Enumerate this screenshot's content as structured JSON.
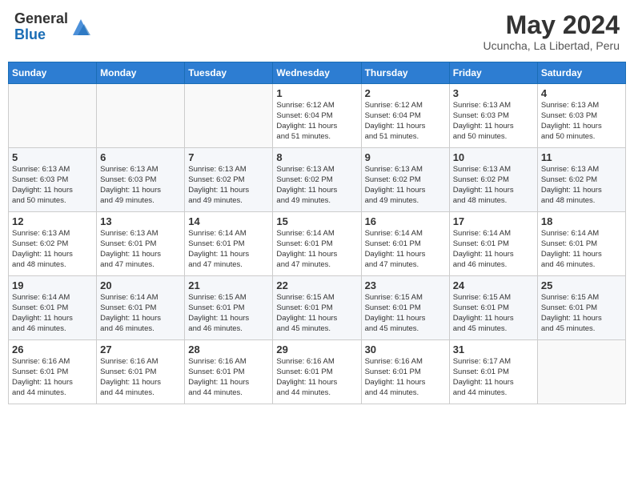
{
  "header": {
    "logo_general": "General",
    "logo_blue": "Blue",
    "month_year": "May 2024",
    "location": "Ucuncha, La Libertad, Peru"
  },
  "columns": [
    "Sunday",
    "Monday",
    "Tuesday",
    "Wednesday",
    "Thursday",
    "Friday",
    "Saturday"
  ],
  "weeks": [
    [
      {
        "day": "",
        "info": ""
      },
      {
        "day": "",
        "info": ""
      },
      {
        "day": "",
        "info": ""
      },
      {
        "day": "1",
        "info": "Sunrise: 6:12 AM\nSunset: 6:04 PM\nDaylight: 11 hours\nand 51 minutes."
      },
      {
        "day": "2",
        "info": "Sunrise: 6:12 AM\nSunset: 6:04 PM\nDaylight: 11 hours\nand 51 minutes."
      },
      {
        "day": "3",
        "info": "Sunrise: 6:13 AM\nSunset: 6:03 PM\nDaylight: 11 hours\nand 50 minutes."
      },
      {
        "day": "4",
        "info": "Sunrise: 6:13 AM\nSunset: 6:03 PM\nDaylight: 11 hours\nand 50 minutes."
      }
    ],
    [
      {
        "day": "5",
        "info": "Sunrise: 6:13 AM\nSunset: 6:03 PM\nDaylight: 11 hours\nand 50 minutes."
      },
      {
        "day": "6",
        "info": "Sunrise: 6:13 AM\nSunset: 6:03 PM\nDaylight: 11 hours\nand 49 minutes."
      },
      {
        "day": "7",
        "info": "Sunrise: 6:13 AM\nSunset: 6:02 PM\nDaylight: 11 hours\nand 49 minutes."
      },
      {
        "day": "8",
        "info": "Sunrise: 6:13 AM\nSunset: 6:02 PM\nDaylight: 11 hours\nand 49 minutes."
      },
      {
        "day": "9",
        "info": "Sunrise: 6:13 AM\nSunset: 6:02 PM\nDaylight: 11 hours\nand 49 minutes."
      },
      {
        "day": "10",
        "info": "Sunrise: 6:13 AM\nSunset: 6:02 PM\nDaylight: 11 hours\nand 48 minutes."
      },
      {
        "day": "11",
        "info": "Sunrise: 6:13 AM\nSunset: 6:02 PM\nDaylight: 11 hours\nand 48 minutes."
      }
    ],
    [
      {
        "day": "12",
        "info": "Sunrise: 6:13 AM\nSunset: 6:02 PM\nDaylight: 11 hours\nand 48 minutes."
      },
      {
        "day": "13",
        "info": "Sunrise: 6:13 AM\nSunset: 6:01 PM\nDaylight: 11 hours\nand 47 minutes."
      },
      {
        "day": "14",
        "info": "Sunrise: 6:14 AM\nSunset: 6:01 PM\nDaylight: 11 hours\nand 47 minutes."
      },
      {
        "day": "15",
        "info": "Sunrise: 6:14 AM\nSunset: 6:01 PM\nDaylight: 11 hours\nand 47 minutes."
      },
      {
        "day": "16",
        "info": "Sunrise: 6:14 AM\nSunset: 6:01 PM\nDaylight: 11 hours\nand 47 minutes."
      },
      {
        "day": "17",
        "info": "Sunrise: 6:14 AM\nSunset: 6:01 PM\nDaylight: 11 hours\nand 46 minutes."
      },
      {
        "day": "18",
        "info": "Sunrise: 6:14 AM\nSunset: 6:01 PM\nDaylight: 11 hours\nand 46 minutes."
      }
    ],
    [
      {
        "day": "19",
        "info": "Sunrise: 6:14 AM\nSunset: 6:01 PM\nDaylight: 11 hours\nand 46 minutes."
      },
      {
        "day": "20",
        "info": "Sunrise: 6:14 AM\nSunset: 6:01 PM\nDaylight: 11 hours\nand 46 minutes."
      },
      {
        "day": "21",
        "info": "Sunrise: 6:15 AM\nSunset: 6:01 PM\nDaylight: 11 hours\nand 46 minutes."
      },
      {
        "day": "22",
        "info": "Sunrise: 6:15 AM\nSunset: 6:01 PM\nDaylight: 11 hours\nand 45 minutes."
      },
      {
        "day": "23",
        "info": "Sunrise: 6:15 AM\nSunset: 6:01 PM\nDaylight: 11 hours\nand 45 minutes."
      },
      {
        "day": "24",
        "info": "Sunrise: 6:15 AM\nSunset: 6:01 PM\nDaylight: 11 hours\nand 45 minutes."
      },
      {
        "day": "25",
        "info": "Sunrise: 6:15 AM\nSunset: 6:01 PM\nDaylight: 11 hours\nand 45 minutes."
      }
    ],
    [
      {
        "day": "26",
        "info": "Sunrise: 6:16 AM\nSunset: 6:01 PM\nDaylight: 11 hours\nand 44 minutes."
      },
      {
        "day": "27",
        "info": "Sunrise: 6:16 AM\nSunset: 6:01 PM\nDaylight: 11 hours\nand 44 minutes."
      },
      {
        "day": "28",
        "info": "Sunrise: 6:16 AM\nSunset: 6:01 PM\nDaylight: 11 hours\nand 44 minutes."
      },
      {
        "day": "29",
        "info": "Sunrise: 6:16 AM\nSunset: 6:01 PM\nDaylight: 11 hours\nand 44 minutes."
      },
      {
        "day": "30",
        "info": "Sunrise: 6:16 AM\nSunset: 6:01 PM\nDaylight: 11 hours\nand 44 minutes."
      },
      {
        "day": "31",
        "info": "Sunrise: 6:17 AM\nSunset: 6:01 PM\nDaylight: 11 hours\nand 44 minutes."
      },
      {
        "day": "",
        "info": ""
      }
    ]
  ]
}
